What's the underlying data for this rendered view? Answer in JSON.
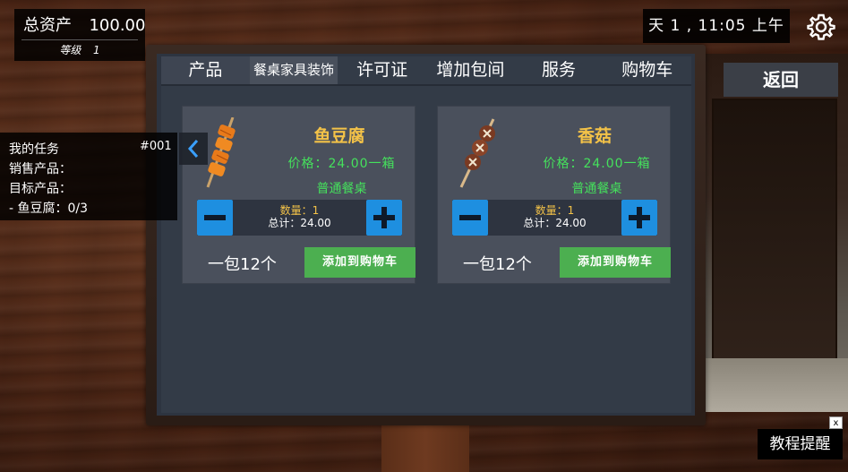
{
  "hud": {
    "assets_label": "总资产",
    "assets_value": "100.00",
    "level_label": "等级",
    "level_value": "1",
    "time_text": "天 1 , 11:05 上午",
    "back_label": "返回",
    "tutorial_label": "教程提醒",
    "tutorial_close": "x"
  },
  "tabs": [
    {
      "label": "产品",
      "active": true
    },
    {
      "label": "餐桌家具装饰",
      "active": false
    },
    {
      "label": "许可证",
      "active": false
    },
    {
      "label": "增加包间",
      "active": false
    },
    {
      "label": "服务",
      "active": false
    },
    {
      "label": "购物车",
      "active": false
    }
  ],
  "products": [
    {
      "name": "鱼豆腐",
      "price_text": "价格：24.00一箱",
      "table_type": "普通餐桌",
      "quantity_text": "数量：1",
      "total_text": "总计：24.00",
      "pack_text": "一包12个",
      "add_label": "添加到购物车",
      "icon": "fish-tofu-skewer-icon"
    },
    {
      "name": "香菇",
      "price_text": "价格：24.00一箱",
      "table_type": "普通餐桌",
      "quantity_text": "数量：1",
      "total_text": "总计：24.00",
      "pack_text": "一包12个",
      "add_label": "添加到购物车",
      "icon": "mushroom-skewer-icon"
    }
  ],
  "quest": {
    "title": "我的任务",
    "id": "#001",
    "sell_label": "销售产品：",
    "target_label": "目标产品：",
    "item_progress": "- 鱼豆腐：0/3"
  },
  "colors": {
    "accent_yellow": "#f3c248",
    "accent_green": "#45e15c",
    "button_blue": "#1e8fe0",
    "cart_green": "#4caf50"
  }
}
